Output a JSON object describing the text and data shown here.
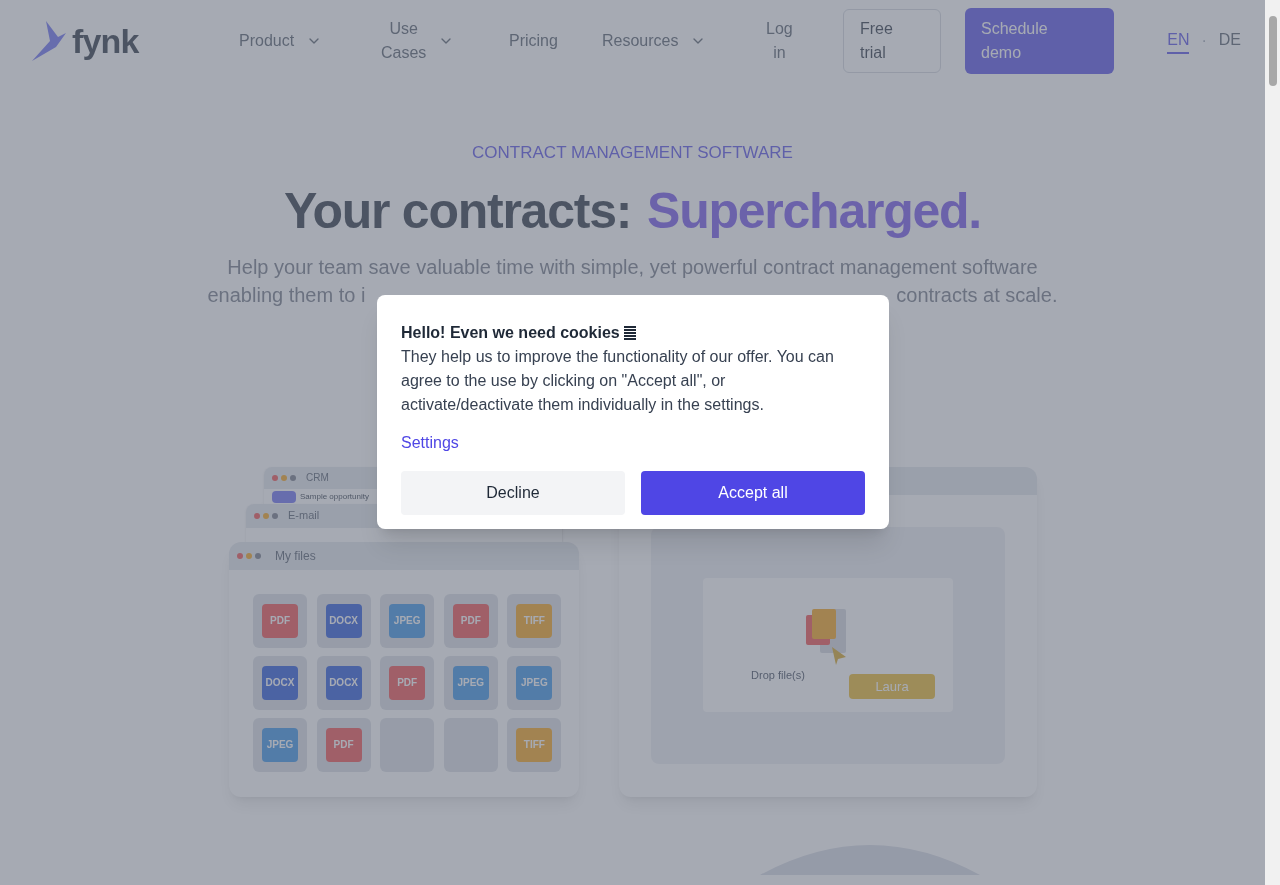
{
  "header": {
    "logo": "fynk",
    "nav": [
      {
        "label": "Product",
        "dropdown": true
      },
      {
        "label": "Use Cases",
        "dropdown": true
      },
      {
        "label": "Pricing",
        "dropdown": false
      },
      {
        "label": "Resources",
        "dropdown": true
      },
      {
        "label": "Log in",
        "dropdown": false
      }
    ],
    "trial_button": "Free trial",
    "demo_button": "Schedule demo",
    "languages": [
      {
        "label": "EN",
        "selected": true
      },
      {
        "label": "DE",
        "selected": false
      }
    ],
    "language_separator": "·"
  },
  "hero": {
    "eyebrow": "CONTRACT MANAGEMENT SOFTWARE",
    "title": "Your contracts:",
    "title_highlight": "Supercharged.",
    "subtitle_line": "Help your team save valuable time with simple, yet powerful contract management software",
    "subtitle_left": "enabling them to i",
    "subtitle_right": "contracts at scale."
  },
  "mockup": {
    "crm_title": "CRM",
    "crm_item": "Sample opportunity",
    "email_title": "E-mail",
    "files_title": "My files",
    "files": [
      {
        "kind": "pdf",
        "label": "PDF"
      },
      {
        "kind": "docx",
        "label": "DOCX"
      },
      {
        "kind": "jpeg",
        "label": "JPEG"
      },
      {
        "kind": "pdf",
        "label": "PDF"
      },
      {
        "kind": "tiff",
        "label": "TIFF"
      },
      {
        "kind": "docx",
        "label": "DOCX"
      },
      {
        "kind": "docx",
        "label": "DOCX"
      },
      {
        "kind": "pdf",
        "label": "PDF"
      },
      {
        "kind": "jpeg",
        "label": "JPEG"
      },
      {
        "kind": "jpeg",
        "label": "JPEG"
      },
      {
        "kind": "jpeg",
        "label": "JPEG"
      },
      {
        "kind": "pdf",
        "label": "PDF"
      },
      {
        "kind": "empty"
      },
      {
        "kind": "empty"
      },
      {
        "kind": "tiff",
        "label": "TIFF"
      }
    ],
    "drop_text": "Drop file(s)",
    "cursor_label": "Laura"
  },
  "cookie_dialog": {
    "title": "Hello! Even we need cookies",
    "body": "They help us to improve the functionality of our offer. You can agree to the use by clicking on \"Accept all\", or activate/deactivate them individually in the settings.",
    "settings_link": "Settings",
    "decline_button": "Decline",
    "accept_button": "Accept all"
  }
}
